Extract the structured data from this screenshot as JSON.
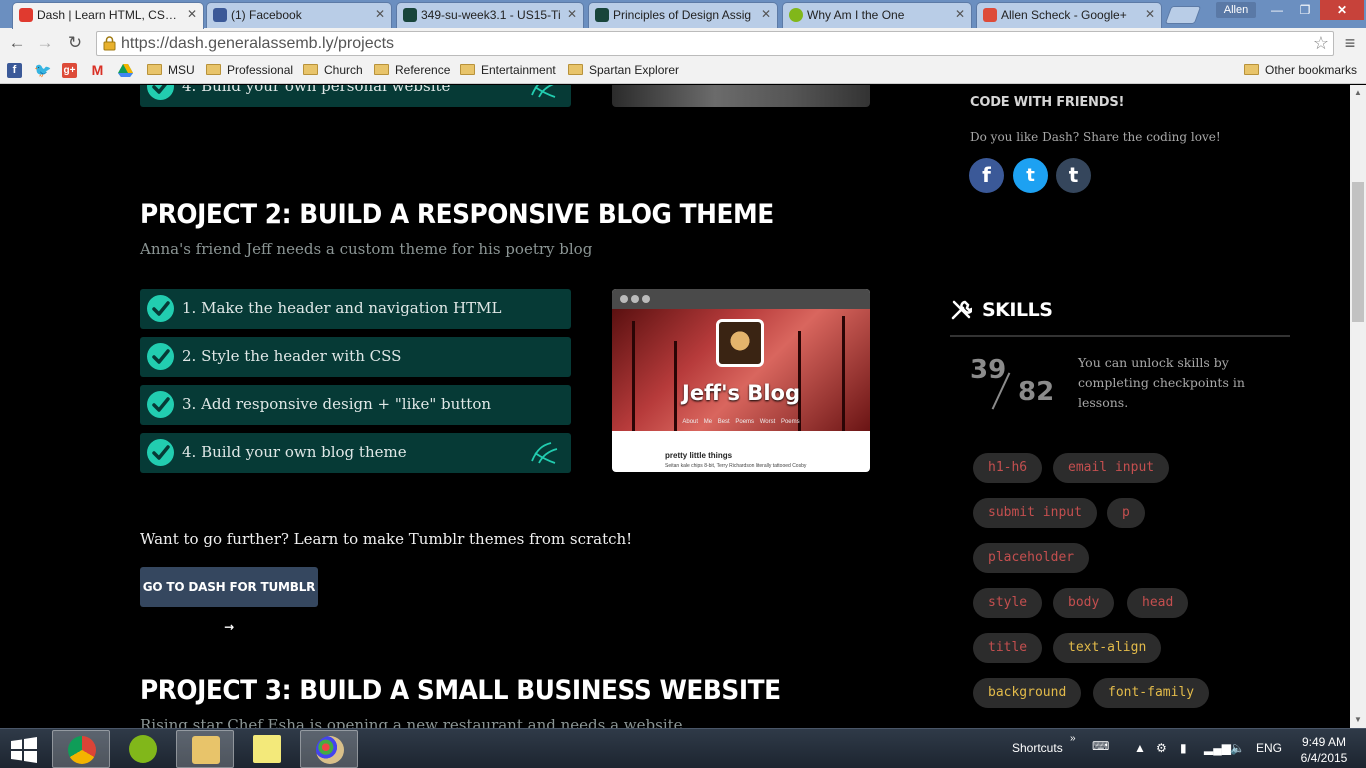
{
  "browser": {
    "tabs": [
      {
        "label": "Dash | Learn HTML, CSS, J",
        "active": true
      },
      {
        "label": "(1) Facebook",
        "active": false
      },
      {
        "label": "349-su-week3.1 - US15-Ti",
        "active": false
      },
      {
        "label": "Principles of Design Assig",
        "active": false
      },
      {
        "label": "Why Am I the One",
        "active": false
      },
      {
        "label": "Allen Scheck - Google+",
        "active": false
      }
    ],
    "user": "Allen",
    "url": "https://dash.generalassemb.ly/projects",
    "bookmarks": [
      "MSU",
      "Professional",
      "Church",
      "Reference",
      "Entertainment",
      "Spartan Explorer"
    ],
    "other_bookmarks": "Other bookmarks",
    "bookmark_icons": {
      "gplus": "g+",
      "gmail": "M"
    }
  },
  "project1": {
    "last_step": "4. Build your own personal website"
  },
  "project2": {
    "title": "PROJECT 2: BUILD A RESPONSIVE BLOG THEME",
    "subtitle": "Anna's friend Jeff needs a custom theme for his poetry blog",
    "steps": [
      "1. Make the header and navigation HTML",
      "2. Style the header with CSS",
      "3. Add responsive design + \"like\" button",
      "4. Build your own blog theme"
    ],
    "preview": {
      "blog_title": "Jeff's Blog",
      "nav": "About Me   Best Poems   Worst Poems",
      "post_title": "pretty little things",
      "post_text": "Seitan kale chips 8-bit, Terry Richardson literally tattooed Cosby"
    }
  },
  "further": {
    "text": "Want to go further? Learn to make Tumblr themes from scratch!",
    "button": "GO TO DASH FOR TUMBLR →"
  },
  "project3": {
    "title": "PROJECT 3: BUILD A SMALL BUSINESS WEBSITE",
    "subtitle": "Rising star Chef Esha is opening a new restaurant and needs a website"
  },
  "sidebar": {
    "code_with_friends": "CODE WITH FRIENDS!",
    "share_text": "Do you like Dash? Share the coding love!",
    "social": {
      "facebook": "f",
      "twitter": "t",
      "tumblr": "t"
    },
    "skills_title": "SKILLS",
    "skills_unlocked": "39",
    "skills_total": "82",
    "skills_desc": "You can unlock skills by completing checkpoints in lessons.",
    "skills": [
      {
        "name": "h1-h6",
        "unlocked": false
      },
      {
        "name": "email input",
        "unlocked": false
      },
      {
        "name": "submit input",
        "unlocked": false
      },
      {
        "name": "p",
        "unlocked": false
      },
      {
        "name": "placeholder",
        "unlocked": false
      },
      {
        "name": "style",
        "unlocked": false
      },
      {
        "name": "body",
        "unlocked": false
      },
      {
        "name": "head",
        "unlocked": false
      },
      {
        "name": "title",
        "unlocked": false
      },
      {
        "name": "text-align",
        "unlocked": true
      },
      {
        "name": "background",
        "unlocked": true
      },
      {
        "name": "font-family",
        "unlocked": true
      }
    ]
  },
  "taskbar": {
    "shortcuts": "Shortcuts",
    "lang": "ENG",
    "time": "9:49 AM",
    "date": "6/4/2015"
  },
  "colors": {
    "accent_teal": "#22cdb0",
    "step_bg": "#063a36",
    "locked_skill": "#c44f4f",
    "unlocked_skill": "#e3bb4a",
    "tumblr_button": "#35475f"
  }
}
